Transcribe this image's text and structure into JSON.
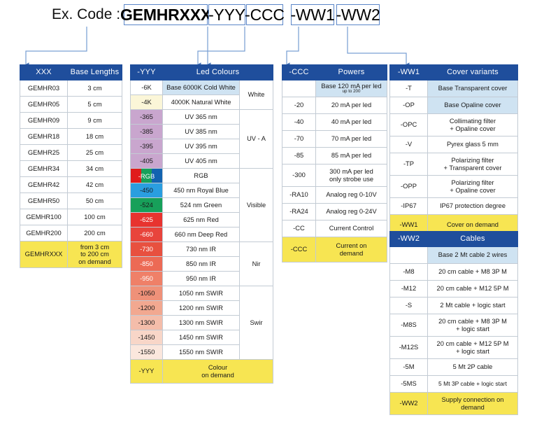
{
  "header": {
    "label": "Ex. Code :",
    "segments": [
      {
        "text": "GEMHRXXX",
        "bold": true
      },
      {
        "text": "-YYY",
        "bold": false
      },
      {
        "text": "-CCC",
        "bold": false
      },
      {
        "text": "-WW1",
        "bold": false
      },
      {
        "text": "-WW2",
        "bold": false
      }
    ]
  },
  "accent": {
    "header_blue": "#1f4e9c",
    "connector_blue": "#5b86c8",
    "base_tint": "#cfe3f2",
    "demand_yellow": "#f7e552"
  },
  "tables": {
    "lengths": {
      "headers": [
        "XXX",
        "Base Lengths"
      ],
      "rows": [
        {
          "code": "GEMHR03",
          "desc": "3 cm"
        },
        {
          "code": "GEMHR05",
          "desc": "5 cm"
        },
        {
          "code": "GEMHR09",
          "desc": "9 cm"
        },
        {
          "code": "GEMHR18",
          "desc": "18 cm"
        },
        {
          "code": "GEMHR25",
          "desc": "25 cm"
        },
        {
          "code": "GEMHR34",
          "desc": "34 cm"
        },
        {
          "code": "GEMHR42",
          "desc": "42 cm"
        },
        {
          "code": "GEMHR50",
          "desc": "50 cm"
        },
        {
          "code": "GEMHR100",
          "desc": "100 cm"
        },
        {
          "code": "GEMHR200",
          "desc": "200 cm"
        }
      ],
      "demand": {
        "code": "GEMHRXXX",
        "desc": "from 3 cm\nto 200 cm\non demand"
      }
    },
    "colours": {
      "headers": [
        "-YYY",
        "Led Colours"
      ],
      "rows": [
        {
          "code": "-6K",
          "desc": "Base 6000K Cold White",
          "swatch": "sw-white",
          "base": true,
          "group": "White"
        },
        {
          "code": "-4K",
          "desc": "4000K Natural White",
          "swatch": "sw-cream",
          "base": false
        },
        {
          "code": "-365",
          "desc": "UV 365 nm",
          "swatch": "sw-uv",
          "base": false,
          "group": "UV - A"
        },
        {
          "code": "-385",
          "desc": "UV 385 nm",
          "swatch": "sw-uv",
          "base": false
        },
        {
          "code": "-395",
          "desc": "UV 395 nm",
          "swatch": "sw-uv",
          "base": false
        },
        {
          "code": "-405",
          "desc": "UV 405 nm",
          "swatch": "sw-uv",
          "base": false
        },
        {
          "code": "-RGB",
          "desc": "RGB",
          "swatch": "rgb",
          "base": false,
          "group": "Visible"
        },
        {
          "code": "-450",
          "desc": "450 nm Royal Blue",
          "swatch": "sw-blue",
          "base": false
        },
        {
          "code": "-524",
          "desc": "524 nm Green",
          "swatch": "sw-green",
          "base": false
        },
        {
          "code": "-625",
          "desc": "625 nm Red",
          "swatch": "sw-red625",
          "base": false
        },
        {
          "code": "-660",
          "desc": "660 nm Deep Red",
          "swatch": "sw-red660",
          "base": false
        },
        {
          "code": "-730",
          "desc": "730 nm IR",
          "swatch": "sw-730",
          "base": false,
          "group": "Nir"
        },
        {
          "code": "-850",
          "desc": "850 nm IR",
          "swatch": "sw-850",
          "base": false
        },
        {
          "code": "-950",
          "desc": "950 nm IR",
          "swatch": "sw-950",
          "base": false
        },
        {
          "code": "-1050",
          "desc": "1050 nm SWIR",
          "swatch": "sw-1050",
          "base": false,
          "group": "Swir"
        },
        {
          "code": "-1200",
          "desc": "1200 nm SWIR",
          "swatch": "sw-1200",
          "base": false
        },
        {
          "code": "-1300",
          "desc": "1300 nm SWIR",
          "swatch": "sw-1300",
          "base": false
        },
        {
          "code": "-1450",
          "desc": "1450 nm SWIR",
          "swatch": "sw-1450",
          "base": false
        },
        {
          "code": "-1550",
          "desc": "1550 nm SWIR",
          "swatch": "sw-1550",
          "base": false
        }
      ],
      "groups": [
        {
          "label": "White",
          "span": 2
        },
        {
          "label": "UV - A",
          "span": 4
        },
        {
          "label": "Visible",
          "span": 5
        },
        {
          "label": "Nir",
          "span": 3
        },
        {
          "label": "Swir",
          "span": 5
        }
      ],
      "demand": {
        "code": "-YYY",
        "desc": "Colour\non demand"
      }
    },
    "powers": {
      "headers": [
        "-CCC",
        "Powers"
      ],
      "rows": [
        {
          "code": "",
          "desc": "Base 120 mA per led",
          "sub": "up to 200",
          "base": true
        },
        {
          "code": "-20",
          "desc": "20 mA per led"
        },
        {
          "code": "-40",
          "desc": "40 mA per led"
        },
        {
          "code": "-70",
          "desc": "70 mA per led"
        },
        {
          "code": "-85",
          "desc": "85 mA per led"
        },
        {
          "code": "-300",
          "desc": "300 mA per led\nonly strobe use"
        },
        {
          "code": "-RA10",
          "desc": "Analog reg 0-10V"
        },
        {
          "code": "-RA24",
          "desc": "Analog reg 0-24V"
        },
        {
          "code": "-CC",
          "desc": "Current Control"
        }
      ],
      "demand": {
        "code": "-CCC",
        "desc": "Current on\ndemand"
      }
    },
    "covers": {
      "headers": [
        "-WW1",
        "Cover variants"
      ],
      "rows": [
        {
          "code": "-T",
          "desc": "Base Transparent cover",
          "base": true
        },
        {
          "code": "-OP",
          "desc": "Base Opaline cover",
          "base": true
        },
        {
          "code": "-OPC",
          "desc": "Collimating filter\n+ Opaline cover"
        },
        {
          "code": "-V",
          "desc": "Pyrex glass 5 mm"
        },
        {
          "code": "-TP",
          "desc": "Polarizing filter\n+ Transparent cover"
        },
        {
          "code": "-OPP",
          "desc": "Polarizing filter\n+ Opaline cover"
        },
        {
          "code": "-IP67",
          "desc": "IP67 protection degree"
        }
      ],
      "demand": {
        "code": "-WW1",
        "desc": "Cover on demand"
      }
    },
    "cables": {
      "headers": [
        "-WW2",
        "Cables"
      ],
      "rows": [
        {
          "code": "",
          "desc": "Base 2 Mt cable 2 wires",
          "base": true
        },
        {
          "code": "-M8",
          "desc": "20 cm cable + M8 3P M"
        },
        {
          "code": "-M12",
          "desc": "20 cm cable + M12 5P M"
        },
        {
          "code": "-S",
          "desc": "2 Mt cable + logic start"
        },
        {
          "code": "-M8S",
          "desc": "20 cm cable + M8 3P M\n+ logic start"
        },
        {
          "code": "-M12S",
          "desc": "20 cm cable + M12 5P M\n+ logic start"
        },
        {
          "code": "-5M",
          "desc": "5 Mt 2P cable"
        },
        {
          "code": "-5MS",
          "desc": "5 Mt 3P cable + logic start",
          "small": true
        }
      ],
      "demand": {
        "code": "-WW2",
        "desc": "Supply connection on\ndemand"
      }
    }
  }
}
